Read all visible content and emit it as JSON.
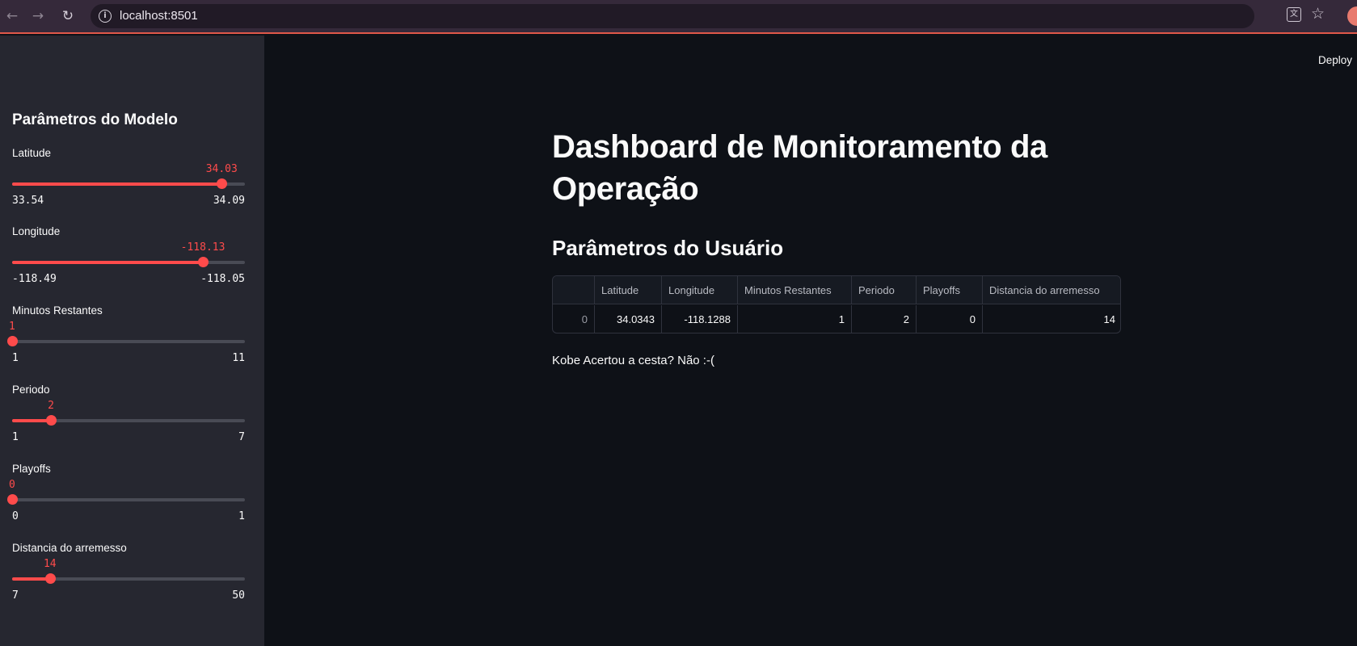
{
  "browser": {
    "back_glyph": "←",
    "forward_glyph": "→",
    "reload_glyph": "↻",
    "url": "localhost:8501",
    "info_glyph": "i",
    "translate_glyph": "文",
    "star_glyph": "☆"
  },
  "sidebar": {
    "title": "Parâmetros do Modelo",
    "sliders": [
      {
        "label": "Latitude",
        "value": "34.03",
        "min": "33.54",
        "max": "34.09",
        "fraction": 0.9
      },
      {
        "label": "Longitude",
        "value": "-118.13",
        "min": "-118.49",
        "max": "-118.05",
        "fraction": 0.82
      },
      {
        "label": "Minutos Restantes",
        "value": "1",
        "min": "1",
        "max": "11",
        "fraction": 0.0
      },
      {
        "label": "Periodo",
        "value": "2",
        "min": "1",
        "max": "7",
        "fraction": 0.167
      },
      {
        "label": "Playoffs",
        "value": "0",
        "min": "0",
        "max": "1",
        "fraction": 0.0
      },
      {
        "label": "Distancia do arremesso",
        "value": "14",
        "min": "7",
        "max": "50",
        "fraction": 0.163
      }
    ]
  },
  "header": {
    "deploy_label": "Deploy"
  },
  "main": {
    "title": "Dashboard de Monitoramento da Operação",
    "section_header": "Parâmetros do Usuário",
    "table": {
      "columns": [
        "",
        "Latitude",
        "Longitude",
        "Minutos Restantes",
        "Periodo",
        "Playoffs",
        "Distancia do arremesso"
      ],
      "rows": [
        [
          "0",
          "34.0343",
          "-118.1288",
          "1",
          "2",
          "0",
          "14"
        ]
      ]
    },
    "result_text": "Kobe Acertou a cesta? Não :-("
  },
  "colors": {
    "accent": "#ff4b4b",
    "background": "#0e1117",
    "sidebar": "#262730",
    "text": "#fafafa"
  }
}
